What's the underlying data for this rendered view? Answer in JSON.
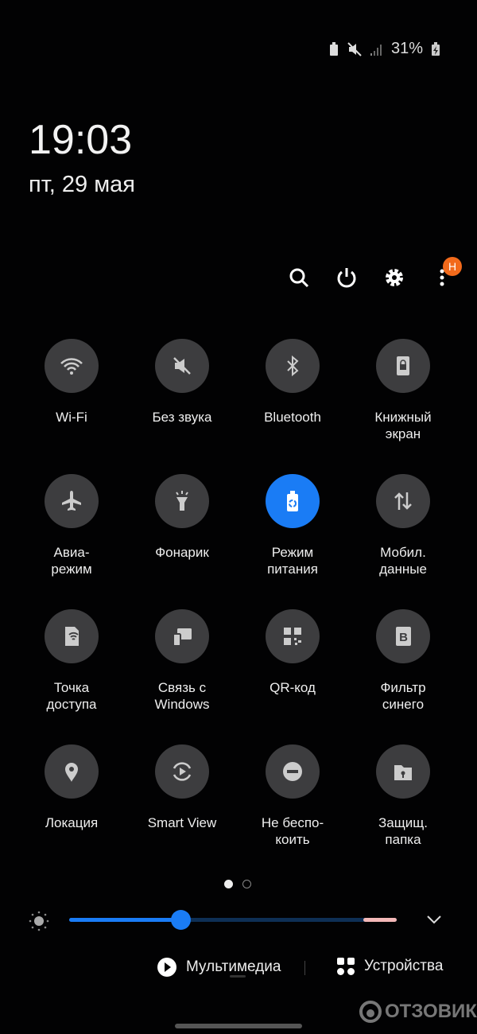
{
  "status_bar": {
    "battery_percent": "31%",
    "icons": [
      "power-saving-icon",
      "mute-icon",
      "signal-icon",
      "battery-charging-icon"
    ]
  },
  "clock": {
    "time": "19:03",
    "date": "пт, 29 мая"
  },
  "header": {
    "icons": [
      "search-icon",
      "power-icon",
      "gear-icon",
      "more-icon"
    ],
    "badge": "Н"
  },
  "tiles": [
    {
      "label": "Wi-Fi",
      "icon": "wifi-icon",
      "active": false
    },
    {
      "label": "Без звука",
      "icon": "mute-icon",
      "active": false
    },
    {
      "label": "Bluetooth",
      "icon": "bluetooth-icon",
      "active": false
    },
    {
      "label": "Книжный\nэкран",
      "icon": "portrait-lock-icon",
      "active": false
    },
    {
      "label": "Авиа-\nрежим",
      "icon": "airplane-icon",
      "active": false
    },
    {
      "label": "Фонарик",
      "icon": "flashlight-icon",
      "active": false
    },
    {
      "label": "Режим\nпитания",
      "icon": "power-saving-icon",
      "active": true
    },
    {
      "label": "Мобил.\nданные",
      "icon": "mobile-data-icon",
      "active": false
    },
    {
      "label": "Точка\nдоступа",
      "icon": "hotspot-icon",
      "active": false
    },
    {
      "label": "Связь с\nWindows",
      "icon": "link-windows-icon",
      "active": false
    },
    {
      "label": "QR-код",
      "icon": "qr-code-icon",
      "active": false
    },
    {
      "label": "Фильтр\nсинего",
      "icon": "blue-light-filter-icon",
      "active": false
    },
    {
      "label": "Локация",
      "icon": "location-icon",
      "active": false
    },
    {
      "label": "Smart View",
      "icon": "smart-view-icon",
      "active": false
    },
    {
      "label": "Не беспо-\nкоить",
      "icon": "do-not-disturb-icon",
      "active": false
    },
    {
      "label": "Защищ.\nпапка",
      "icon": "secure-folder-icon",
      "active": false
    }
  ],
  "pager": {
    "pages": 2,
    "current": 1
  },
  "brightness": {
    "percent": 34
  },
  "bottom": {
    "media_label": "Мультимедиа",
    "devices_label": "Устройства"
  },
  "watermark": "ОТЗОВИК",
  "colors": {
    "accent": "#1a7cf5",
    "tile": "#3d3d3f",
    "badge": "#f26a1b"
  }
}
